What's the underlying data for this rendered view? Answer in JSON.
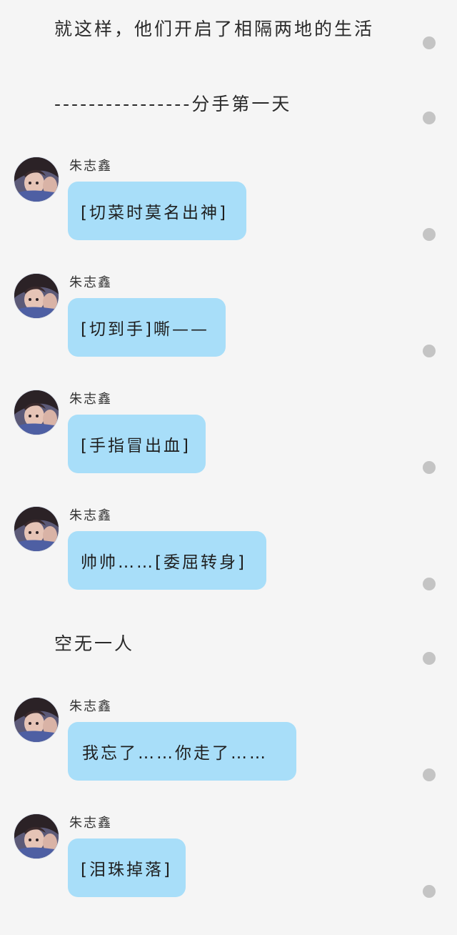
{
  "colors": {
    "background": "#f5f5f5",
    "bubble": "#a8def9",
    "dot": "#c4c4c4"
  },
  "story": {
    "intro": "就这样，他们开启了相隔两地的生活",
    "divider": "----------------分手第一天",
    "interlude": "空无一人"
  },
  "messages": [
    {
      "sender": "朱志鑫",
      "text": "[切菜时莫名出神]",
      "avatar": "avatar-photo"
    },
    {
      "sender": "朱志鑫",
      "text": "[切到手]嘶——",
      "avatar": "avatar-photo"
    },
    {
      "sender": "朱志鑫",
      "text": "[手指冒出血]",
      "avatar": "avatar-photo"
    },
    {
      "sender": "朱志鑫",
      "text": "帅帅……[委屈转身]",
      "avatar": "avatar-photo"
    },
    {
      "sender": "朱志鑫",
      "text": "我忘了……你走了……",
      "avatar": "avatar-photo"
    },
    {
      "sender": "朱志鑫",
      "text": "[泪珠掉落]",
      "avatar": "avatar-photo"
    }
  ]
}
